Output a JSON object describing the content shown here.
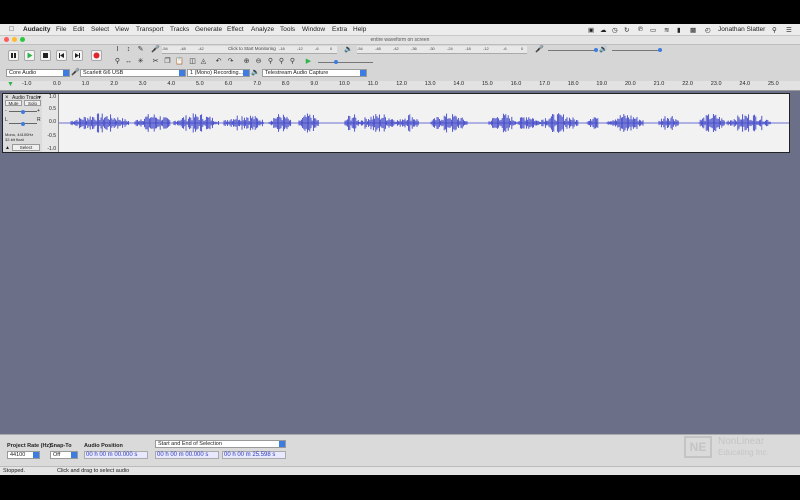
{
  "menubar": {
    "app": "Audacity",
    "items": [
      "File",
      "Edit",
      "Select",
      "View",
      "Transport",
      "Tracks",
      "Generate",
      "Effect",
      "Analyze",
      "Tools",
      "Window",
      "Extra",
      "Help"
    ],
    "user": "Jonathan Slatter"
  },
  "window": {
    "title": "entire waveform on screen"
  },
  "toolbar": {
    "monitor_label": "Click to Start Monitoring",
    "rec_meter_ticks": [
      "-54",
      "-48",
      "-42",
      "-36",
      "-30",
      "-24",
      "-18",
      "-12",
      "-6",
      "0"
    ],
    "play_meter_ticks": [
      "-54",
      "-48",
      "-42",
      "-36",
      "-30",
      "-24",
      "-18",
      "-12",
      "-6",
      "0"
    ],
    "device": {
      "host": "Core Audio",
      "input": "Scarlett 6i6 USB",
      "channels": "1 (Mono) Recording...",
      "output": "Telestream Audio Capture"
    }
  },
  "ruler": {
    "ticks": [
      "-1.0",
      "0.0",
      "1.0",
      "2.0",
      "3.0",
      "4.0",
      "5.0",
      "6.0",
      "7.0",
      "8.0",
      "9.0",
      "10.0",
      "11.0",
      "12.0",
      "13.0",
      "14.0",
      "15.0",
      "16.0",
      "17.0",
      "18.0",
      "19.0",
      "20.0",
      "21.0",
      "22.0",
      "23.0",
      "24.0",
      "25.0"
    ]
  },
  "track": {
    "name": "Audio Track",
    "mute": "Mute",
    "solo": "Solo",
    "gain_minus": "-",
    "gain_plus": "+",
    "pan_left": "L",
    "pan_right": "R",
    "info": "Mono, 44100Hz\n32-bit float",
    "select": "Select",
    "scale": [
      "1.0",
      "0.5",
      "0.0",
      "-0.5",
      "-1.0"
    ],
    "waveform_color": "#3e45c8"
  },
  "bottom": {
    "project_rate_label": "Project Rate (Hz)",
    "project_rate": "44100",
    "snap_to_label": "Snap-To",
    "snap_to": "Off",
    "audio_position_label": "Audio Position",
    "audio_position": "00 h 00 m 00.000 s",
    "selection_mode": "Start and End of Selection",
    "sel_start": "00 h 00 m 00.000 s",
    "sel_end": "00 h 00 m 25.598 s"
  },
  "status": {
    "left": "Stopped.",
    "hint": "Click and drag to select audio"
  },
  "logo": {
    "mark": "NE",
    "line1": "NonLinear",
    "line2": "Educating Inc."
  },
  "colors": {
    "track_bg": "#6b7088",
    "accent": "#3d7ce0",
    "record": "#e0242b",
    "play": "#2fb64a"
  }
}
